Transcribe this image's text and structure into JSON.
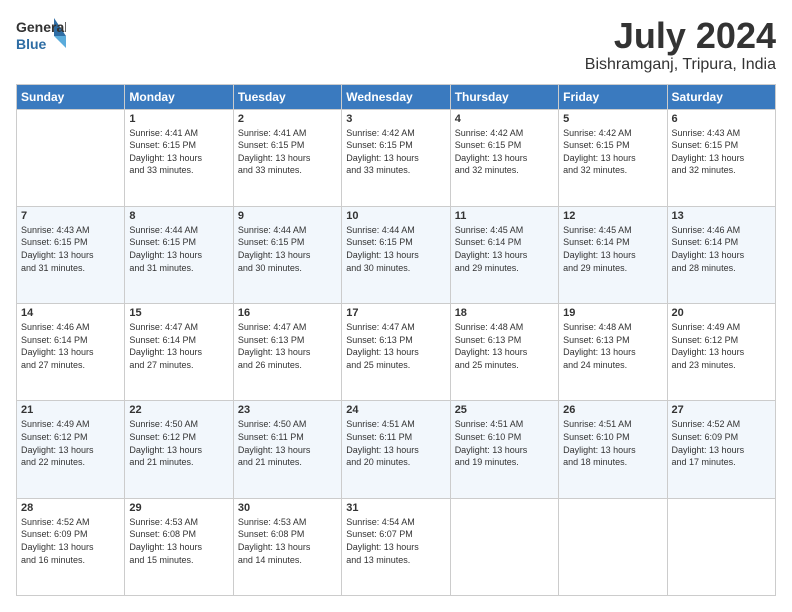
{
  "header": {
    "logo_general": "General",
    "logo_blue": "Blue",
    "month": "July 2024",
    "location": "Bishramganj, Tripura, India"
  },
  "weekdays": [
    "Sunday",
    "Monday",
    "Tuesday",
    "Wednesday",
    "Thursday",
    "Friday",
    "Saturday"
  ],
  "weeks": [
    [
      {
        "day": "",
        "info": ""
      },
      {
        "day": "1",
        "info": "Sunrise: 4:41 AM\nSunset: 6:15 PM\nDaylight: 13 hours\nand 33 minutes."
      },
      {
        "day": "2",
        "info": "Sunrise: 4:41 AM\nSunset: 6:15 PM\nDaylight: 13 hours\nand 33 minutes."
      },
      {
        "day": "3",
        "info": "Sunrise: 4:42 AM\nSunset: 6:15 PM\nDaylight: 13 hours\nand 33 minutes."
      },
      {
        "day": "4",
        "info": "Sunrise: 4:42 AM\nSunset: 6:15 PM\nDaylight: 13 hours\nand 32 minutes."
      },
      {
        "day": "5",
        "info": "Sunrise: 4:42 AM\nSunset: 6:15 PM\nDaylight: 13 hours\nand 32 minutes."
      },
      {
        "day": "6",
        "info": "Sunrise: 4:43 AM\nSunset: 6:15 PM\nDaylight: 13 hours\nand 32 minutes."
      }
    ],
    [
      {
        "day": "7",
        "info": "Sunrise: 4:43 AM\nSunset: 6:15 PM\nDaylight: 13 hours\nand 31 minutes."
      },
      {
        "day": "8",
        "info": "Sunrise: 4:44 AM\nSunset: 6:15 PM\nDaylight: 13 hours\nand 31 minutes."
      },
      {
        "day": "9",
        "info": "Sunrise: 4:44 AM\nSunset: 6:15 PM\nDaylight: 13 hours\nand 30 minutes."
      },
      {
        "day": "10",
        "info": "Sunrise: 4:44 AM\nSunset: 6:15 PM\nDaylight: 13 hours\nand 30 minutes."
      },
      {
        "day": "11",
        "info": "Sunrise: 4:45 AM\nSunset: 6:14 PM\nDaylight: 13 hours\nand 29 minutes."
      },
      {
        "day": "12",
        "info": "Sunrise: 4:45 AM\nSunset: 6:14 PM\nDaylight: 13 hours\nand 29 minutes."
      },
      {
        "day": "13",
        "info": "Sunrise: 4:46 AM\nSunset: 6:14 PM\nDaylight: 13 hours\nand 28 minutes."
      }
    ],
    [
      {
        "day": "14",
        "info": "Sunrise: 4:46 AM\nSunset: 6:14 PM\nDaylight: 13 hours\nand 27 minutes."
      },
      {
        "day": "15",
        "info": "Sunrise: 4:47 AM\nSunset: 6:14 PM\nDaylight: 13 hours\nand 27 minutes."
      },
      {
        "day": "16",
        "info": "Sunrise: 4:47 AM\nSunset: 6:13 PM\nDaylight: 13 hours\nand 26 minutes."
      },
      {
        "day": "17",
        "info": "Sunrise: 4:47 AM\nSunset: 6:13 PM\nDaylight: 13 hours\nand 25 minutes."
      },
      {
        "day": "18",
        "info": "Sunrise: 4:48 AM\nSunset: 6:13 PM\nDaylight: 13 hours\nand 25 minutes."
      },
      {
        "day": "19",
        "info": "Sunrise: 4:48 AM\nSunset: 6:13 PM\nDaylight: 13 hours\nand 24 minutes."
      },
      {
        "day": "20",
        "info": "Sunrise: 4:49 AM\nSunset: 6:12 PM\nDaylight: 13 hours\nand 23 minutes."
      }
    ],
    [
      {
        "day": "21",
        "info": "Sunrise: 4:49 AM\nSunset: 6:12 PM\nDaylight: 13 hours\nand 22 minutes."
      },
      {
        "day": "22",
        "info": "Sunrise: 4:50 AM\nSunset: 6:12 PM\nDaylight: 13 hours\nand 21 minutes."
      },
      {
        "day": "23",
        "info": "Sunrise: 4:50 AM\nSunset: 6:11 PM\nDaylight: 13 hours\nand 21 minutes."
      },
      {
        "day": "24",
        "info": "Sunrise: 4:51 AM\nSunset: 6:11 PM\nDaylight: 13 hours\nand 20 minutes."
      },
      {
        "day": "25",
        "info": "Sunrise: 4:51 AM\nSunset: 6:10 PM\nDaylight: 13 hours\nand 19 minutes."
      },
      {
        "day": "26",
        "info": "Sunrise: 4:51 AM\nSunset: 6:10 PM\nDaylight: 13 hours\nand 18 minutes."
      },
      {
        "day": "27",
        "info": "Sunrise: 4:52 AM\nSunset: 6:09 PM\nDaylight: 13 hours\nand 17 minutes."
      }
    ],
    [
      {
        "day": "28",
        "info": "Sunrise: 4:52 AM\nSunset: 6:09 PM\nDaylight: 13 hours\nand 16 minutes."
      },
      {
        "day": "29",
        "info": "Sunrise: 4:53 AM\nSunset: 6:08 PM\nDaylight: 13 hours\nand 15 minutes."
      },
      {
        "day": "30",
        "info": "Sunrise: 4:53 AM\nSunset: 6:08 PM\nDaylight: 13 hours\nand 14 minutes."
      },
      {
        "day": "31",
        "info": "Sunrise: 4:54 AM\nSunset: 6:07 PM\nDaylight: 13 hours\nand 13 minutes."
      },
      {
        "day": "",
        "info": ""
      },
      {
        "day": "",
        "info": ""
      },
      {
        "day": "",
        "info": ""
      }
    ]
  ]
}
